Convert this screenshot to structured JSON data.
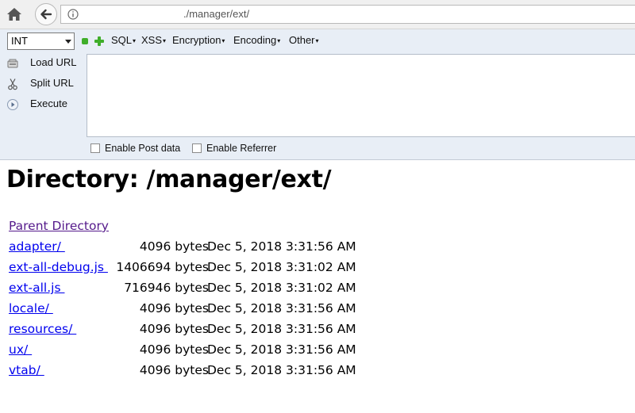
{
  "browser": {
    "url_visible": "./manager/ext/"
  },
  "hackbar": {
    "select_value": "INT",
    "menus": [
      {
        "label": "SQL",
        "caret": "▾"
      },
      {
        "label": "XSS",
        "caret": "▾"
      },
      {
        "label": "Encryption",
        "caret": "▾"
      },
      {
        "label": "Encoding",
        "caret": "▾"
      },
      {
        "label": "Other",
        "caret": "▾"
      }
    ],
    "actions": [
      {
        "label": "Load URL",
        "icon": "load-url-icon"
      },
      {
        "label": "Split URL",
        "icon": "scissors-icon"
      },
      {
        "label": "Execute",
        "icon": "play-icon"
      }
    ],
    "checkboxes": [
      {
        "label": "Enable Post data",
        "checked": false
      },
      {
        "label": "Enable Referrer",
        "checked": false
      }
    ]
  },
  "page": {
    "title": "Directory: /manager/ext/",
    "parent_link": "Parent Directory",
    "entries": [
      {
        "name": "adapter/ ",
        "size": "4096 bytes",
        "date": "Dec 5, 2018 3:31:56 AM"
      },
      {
        "name": "ext-all-debug.js ",
        "size": "1406694 bytes",
        "date": "Dec 5, 2018 3:31:02 AM"
      },
      {
        "name": "ext-all.js ",
        "size": "716946 bytes",
        "date": "Dec 5, 2018 3:31:02 AM"
      },
      {
        "name": "locale/ ",
        "size": "4096 bytes",
        "date": "Dec 5, 2018 3:31:56 AM"
      },
      {
        "name": "resources/ ",
        "size": "4096 bytes",
        "date": "Dec 5, 2018 3:31:56 AM"
      },
      {
        "name": "ux/ ",
        "size": "4096 bytes",
        "date": "Dec 5, 2018 3:31:56 AM"
      },
      {
        "name": "vtab/ ",
        "size": "4096 bytes",
        "date": "Dec 5, 2018 3:31:56 AM"
      }
    ]
  },
  "colors": {
    "link": "#0000ee",
    "visited_link": "#551a8b",
    "hackbar_bg": "#e8eef6",
    "accent_green": "#3fae2a"
  }
}
